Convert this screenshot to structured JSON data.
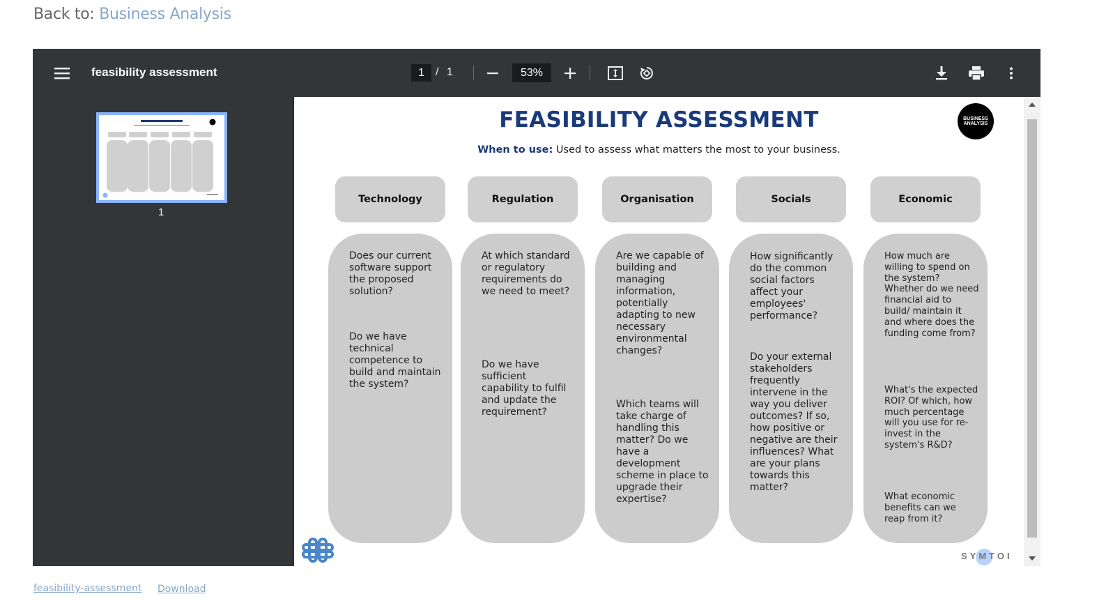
{
  "back": {
    "prefix": "Back to: ",
    "link": "Business Analysis"
  },
  "toolbar": {
    "title": "feasibility assessment",
    "current_page": "1",
    "page_sep": "/",
    "total_pages": "1",
    "zoom": "53%"
  },
  "sidebar": {
    "thumb_label": "1"
  },
  "page": {
    "title": "FEASIBILITY ASSESSMENT",
    "when_label": "When to use:",
    "when_text": " Used to assess what matters the most to your business.",
    "logo_text": "BUSINESS ANALYSIS",
    "brand": "SYMTOI",
    "columns": [
      {
        "heading": "Technology",
        "questions": [
          "Does our current software support the proposed solution?",
          "Do we have technical competence to build and maintain the system?"
        ]
      },
      {
        "heading": "Regulation",
        "questions": [
          "At which standard or regulatory requirements do we need to meet?",
          "Do we have sufficient capability to fulfil and update the requirement?"
        ]
      },
      {
        "heading": "Organisation",
        "questions": [
          "Are we capable of building and managing information, potentially adapting to new necessary environmental changes?",
          "Which teams will take charge of handling this matter? Do we have a development scheme in place to upgrade their expertise?"
        ]
      },
      {
        "heading": "Socials",
        "questions": [
          "How significantly do the common social factors affect your employees' performance?",
          "Do your external stakeholders frequently intervene in the way you deliver outcomes? If so, how positive or negative are their influences? What are your plans towards this matter?"
        ]
      },
      {
        "heading": "Economic",
        "questions": [
          "How much are willing to spend on the system? Whether do we need financial aid to build/ maintain it and where does the funding come from?",
          "What's the expected ROI? Of which, how much percentage will you use for re-invest in the system's R&D?",
          "What economic benefits can we reap from it?"
        ]
      }
    ]
  },
  "footer": {
    "file_link": "feasibility-assessment",
    "download_link": "Download"
  },
  "colors": {
    "link": "#86a7c9",
    "toolbar_bg": "#323639",
    "title_blue": "#1a3a7a",
    "card_grey": "#cccccc",
    "thumb_border": "#8ab4f8"
  },
  "icons": [
    "menu-icon",
    "zoom-out-icon",
    "zoom-in-icon",
    "fit-page-icon",
    "rotate-icon",
    "download-icon",
    "print-icon",
    "more-icon"
  ]
}
